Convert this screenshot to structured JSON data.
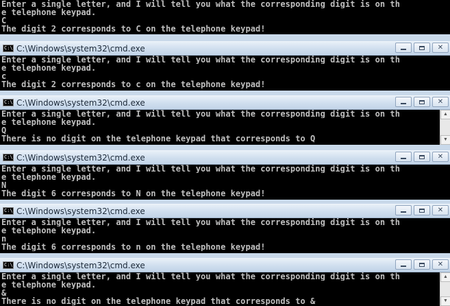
{
  "windows": [
    {
      "title": "",
      "lines": [
        "Enter a single letter, and I will tell you what the corresponding digit is on th",
        "e telephone keypad.",
        "C",
        "The digit 2 corresponds to C on the telephone keypad!"
      ]
    },
    {
      "title": "C:\\Windows\\system32\\cmd.exe",
      "lines": [
        "Enter a single letter, and I will tell you what the corresponding digit is on th",
        "e telephone keypad.",
        "c",
        "The digit 2 corresponds to c on the telephone keypad!"
      ]
    },
    {
      "title": "C:\\Windows\\system32\\cmd.exe",
      "lines": [
        "Enter a single letter, and I will tell you what the corresponding digit is on th",
        "e telephone keypad.",
        "Q",
        "There is no digit on the telephone keypad that corresponds to Q"
      ]
    },
    {
      "title": "C:\\Windows\\system32\\cmd.exe",
      "lines": [
        "Enter a single letter, and I will tell you what the corresponding digit is on th",
        "e telephone keypad.",
        "N",
        "The digit 6 corresponds to N on the telephone keypad!"
      ]
    },
    {
      "title": "C:\\Windows\\system32\\cmd.exe",
      "lines": [
        "Enter a single letter, and I will tell you what the corresponding digit is on th",
        "e telephone keypad.",
        "n",
        "The digit 6 corresponds to n on the telephone keypad!"
      ]
    },
    {
      "title": "C:\\Windows\\system32\\cmd.exe",
      "lines": [
        "Enter a single letter, and I will tell you what the corresponding digit is on th",
        "e telephone keypad.",
        "&",
        "There is no digit on the telephone keypad that corresponds to &"
      ]
    }
  ],
  "icons": {
    "app": "cmd-icon",
    "minimize": "minimize-icon",
    "maximize": "maximize-icon",
    "close": "close-icon"
  },
  "colors": {
    "console_bg": "#000000",
    "console_text": "#c0c0c0",
    "titlebar": "#cfdeee"
  }
}
